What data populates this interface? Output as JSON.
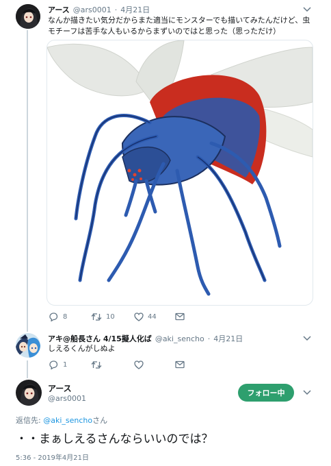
{
  "tweet1": {
    "display_name": "アース",
    "handle": "@ars0001",
    "separator": "·",
    "date": "4月21日",
    "text": "なんか描きたい気分だからまた適当にモンスターでも描いてみたんだけど、虫モチーフは苦手な人もいるからまずいのではと思った（思っただけ）",
    "image_alt": "spider-insect monster drawing",
    "reply_count": "8",
    "retweet_count": "10",
    "like_count": "44"
  },
  "tweet2": {
    "display_name": "アキ@船長さん 4/15擬人化ば",
    "handle": "@aki_sencho",
    "separator": "·",
    "date": "4月21日",
    "text": "しえるくんがしぬよ",
    "reply_count": "1"
  },
  "main_tweet": {
    "display_name": "アース",
    "handle": "@ars0001",
    "follow_label": "フォロー中",
    "reply_to_prefix": "返信先: ",
    "reply_to_handle": "@aki_sencho",
    "reply_to_suffix": "さん",
    "text": "・・まぁしえるさんならいいのでは？",
    "timestamp": "5:36 - 2019年4月21日"
  },
  "colors": {
    "accent_green": "#2e9f6e",
    "link_blue": "#1b95e0",
    "muted_gray": "#657786",
    "thread_line": "#ccd6dd"
  }
}
